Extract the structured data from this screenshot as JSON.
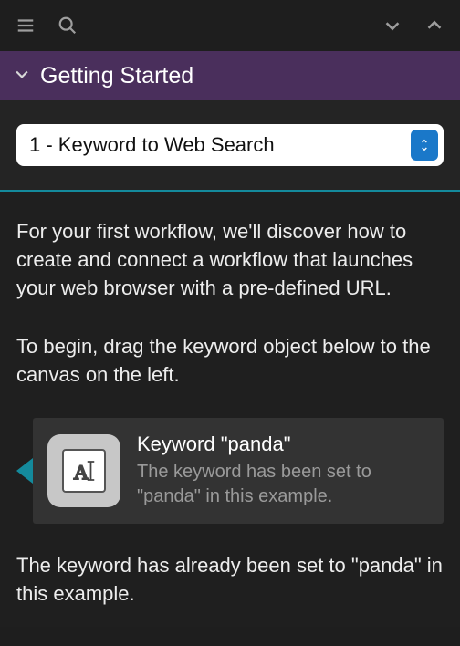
{
  "toolbar": {
    "menu_icon": "menu",
    "search_icon": "search",
    "down_icon": "chevron-down",
    "up_icon": "chevron-up"
  },
  "section": {
    "title": "Getting Started"
  },
  "selector": {
    "selected_label": "1 - Keyword to Web Search"
  },
  "body": {
    "para1": "For your first workflow, we'll discover how to create and connect a workflow that launches your web browser with a pre-defined URL.",
    "para2": "To begin, drag the keyword object below to the canvas on the left.",
    "para3": "The keyword has already been set to \"panda\" in this example."
  },
  "object": {
    "title": "Keyword \"panda\"",
    "subtitle": "The keyword has been set to \"panda\" in this example.",
    "icon_glyph": "A"
  },
  "colors": {
    "accent": "#148a9c",
    "header_bg": "#4a2f5c"
  }
}
